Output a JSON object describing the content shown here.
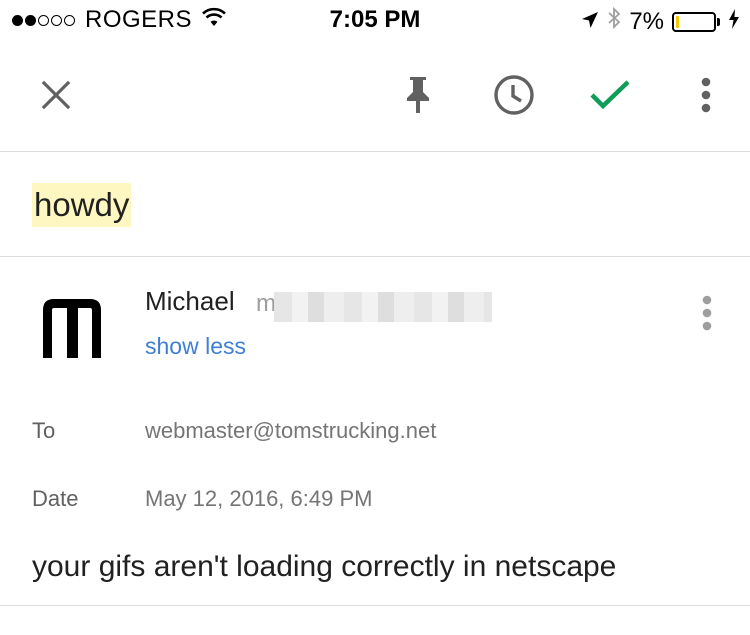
{
  "status_bar": {
    "carrier": "ROGERS",
    "time": "7:05 PM",
    "battery_percent": "7%",
    "battery_level": 0.07,
    "signal_bars_filled": 2,
    "signal_bars_total": 5
  },
  "toolbar": {
    "icons": [
      "close-icon",
      "pin-icon",
      "clock-icon",
      "check-icon",
      "more-vert-icon"
    ],
    "check_color": "#0f9d58"
  },
  "email": {
    "subject": "howdy",
    "sender_name": "Michael",
    "sender_email_visible": "m",
    "show_less_label": "show less",
    "to_label": "To",
    "to_value": "webmaster@tomstrucking.net",
    "date_label": "Date",
    "date_value": "May 12, 2016, 6:49 PM",
    "body": "your gifs aren't loading correctly in netscape"
  },
  "colors": {
    "highlight": "#fff7c2",
    "link": "#3d7fd6"
  }
}
